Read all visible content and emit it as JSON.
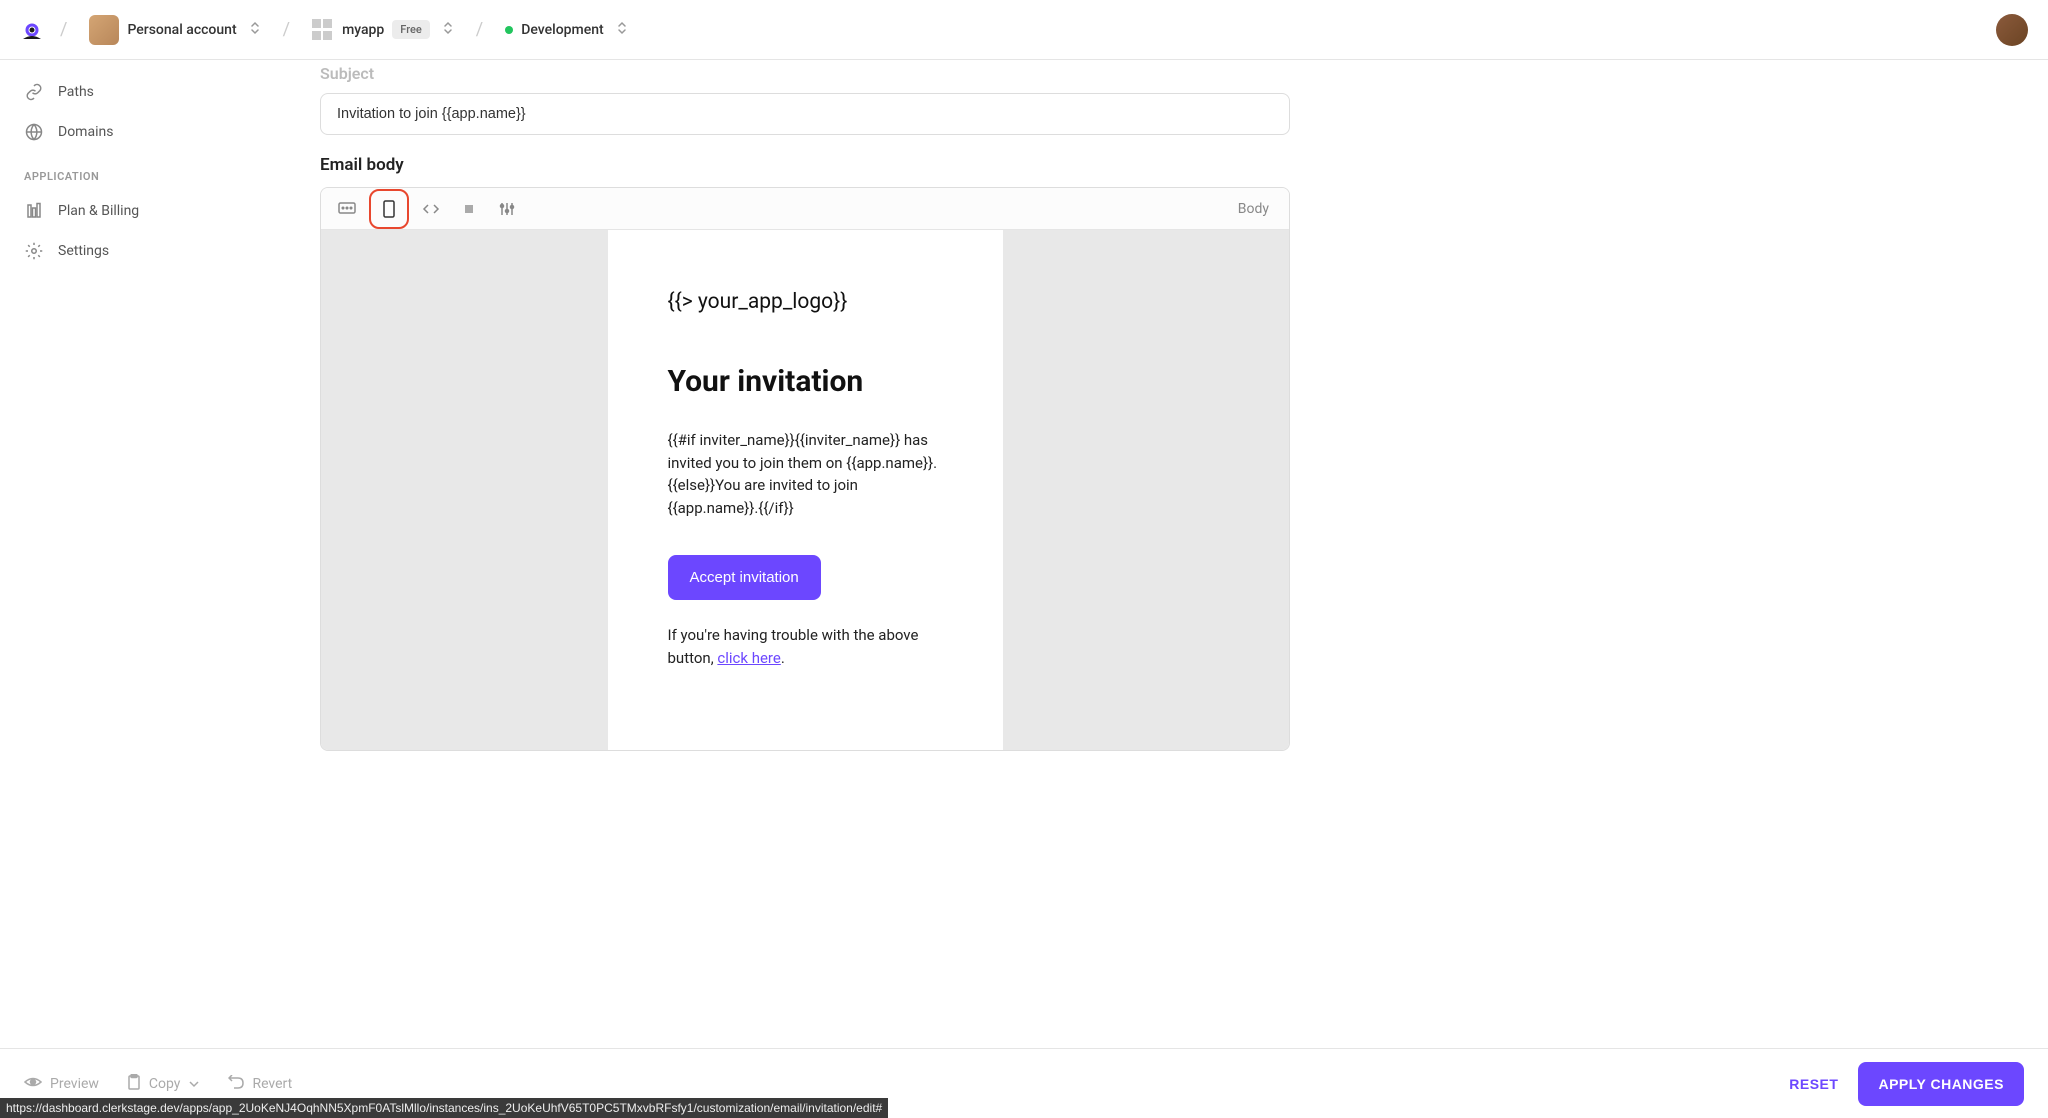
{
  "header": {
    "account_label": "Personal account",
    "app_name": "myapp",
    "plan_badge": "Free",
    "env_label": "Development"
  },
  "sidebar": {
    "items": {
      "paths": "Paths",
      "domains": "Domains",
      "plan_billing": "Plan & Billing",
      "settings": "Settings"
    },
    "section_application": "APPLICATION"
  },
  "form": {
    "subject_label": "Subject",
    "subject_value": "Invitation to join {{app.name}}",
    "body_label": "Email body",
    "toolbar_right": "Body"
  },
  "email_preview": {
    "logo_token": "{{> your_app_logo}}",
    "heading": "Your invitation",
    "body_text": "{{#if inviter_name}}{{inviter_name}} has invited you to join them on {{app.name}}.{{else}}You are invited to join {{app.name}}.{{/if}}",
    "cta": "Accept invitation",
    "help_prefix": "If you're having trouble with the above button, ",
    "help_link": "click here",
    "help_suffix": "."
  },
  "bottombar": {
    "preview": "Preview",
    "copy": "Copy",
    "revert": "Revert",
    "reset": "RESET",
    "apply": "APPLY CHANGES"
  },
  "status_url": "https://dashboard.clerkstage.dev/apps/app_2UoKeNJ4OqhNN5XpmF0ATslMllo/instances/ins_2UoKeUhfV65T0PC5TMxvbRFsfy1/customization/email/invitation/edit#"
}
